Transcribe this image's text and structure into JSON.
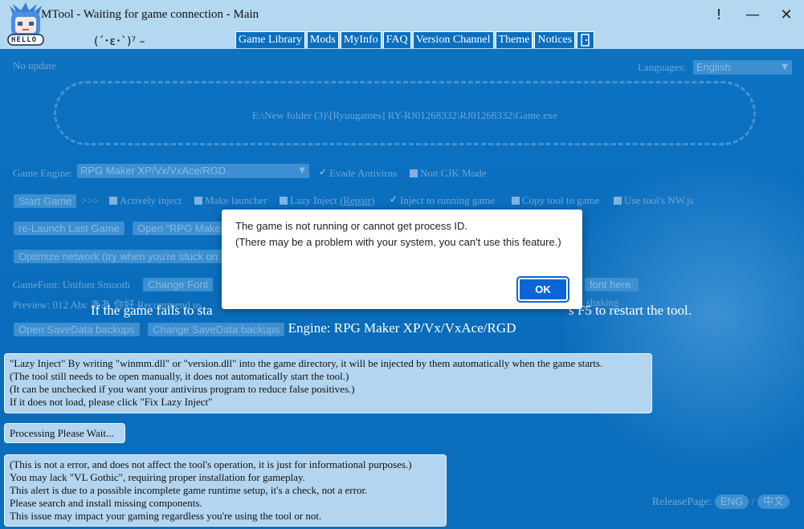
{
  "window": {
    "title": "MTool - Waiting for game connection - Main",
    "help_label": "!",
    "minimize_label": "—",
    "close_label": "✕",
    "avatar_text": "HELLO"
  },
  "tabbar": {
    "kaomoji": "(´･ε･`)⁷ –",
    "tabs": [
      "Game Library",
      "Mods",
      "MyInfo",
      "FAQ",
      "Version Channel",
      "Theme",
      "Notices"
    ]
  },
  "main": {
    "update_status": "No update",
    "languages_label": "Languages:",
    "language_value": "English",
    "game_path": "E:\\New folder (3)\\[Ryuugames] RY-RJ01268332\\RJ01268332\\Game.exe",
    "engine_label": "Game Engine:",
    "engine_value": "RPG Maker XP/Vx/VxAce/RGD",
    "evade_antivirus": "Evade Antivirus",
    "non_cjk_mode": "Non CJK Mode",
    "start_game": "Start Game",
    "arrows": ">>>",
    "actively_inject": "Actively inject",
    "make_launcher": "Make launcher",
    "lazy_inject": "Lazy Inject",
    "repair": "(Repair)",
    "inject_running": "Inject to running game",
    "copy_tool": "Copy tool to game",
    "use_nwjs": "Use tool's NW.js",
    "relaunch": "re-Launch Last Game",
    "open_rpg": "Open \"RPG Make",
    "optimize_network": "Optimize network (try when you're stuck on",
    "gamefont_label": "GameFont: Unifont Smooth",
    "change_font": "Change Font",
    "font_here": "font here.",
    "preview_label": "Preview: 012 Abc ああ 你好 Recommend us",
    "shaking": "shaking",
    "notice_line1": "If the game fails to start properly, try to restart the game process or press F5 to restart the tool.",
    "notice_line1_visible_left": "If the game fails to sta",
    "notice_line1_visible_right": "s F5 to restart the tool.",
    "engine_line": "Engine: RPG Maker XP/Vx/VxAce/RGD",
    "open_savedata": "Open SaveData backups",
    "change_savedata": "Change SaveData backups"
  },
  "info_lazy": [
    "\"Lazy Inject\" By writing \"winmm.dll\" or \"version.dll\" into the game directory, it will be injected by them automatically when the game starts.",
    "(The tool still needs to be open manually, it does not automatically start the tool.)",
    "(It can be unchecked if you want your antivirus program to reduce false positives.)",
    "If it does not load, please click \"Fix Lazy Inject\""
  ],
  "processing": "Processing Please Wait...",
  "info_font": [
    "(This is not a error, and does not affect the tool's operation, it is just for informational purposes.)",
    "You may lack \"VL Gothic\", requiring proper installation for gameplay.",
    "This alert is due to a possible incomplete game runtime setup, it's a check, not a error.",
    "Please search and install missing components.",
    "This issue may impact your gaming regardless you're using the tool or not."
  ],
  "release": {
    "label": "ReleasePage:",
    "eng": "ENG",
    "sep": "/",
    "zh": "中文"
  },
  "dialog": {
    "line1": "The game is not running or cannot get process ID.",
    "line2": "(There may be a problem with your system, you can't use this feature.)",
    "ok": "OK"
  }
}
